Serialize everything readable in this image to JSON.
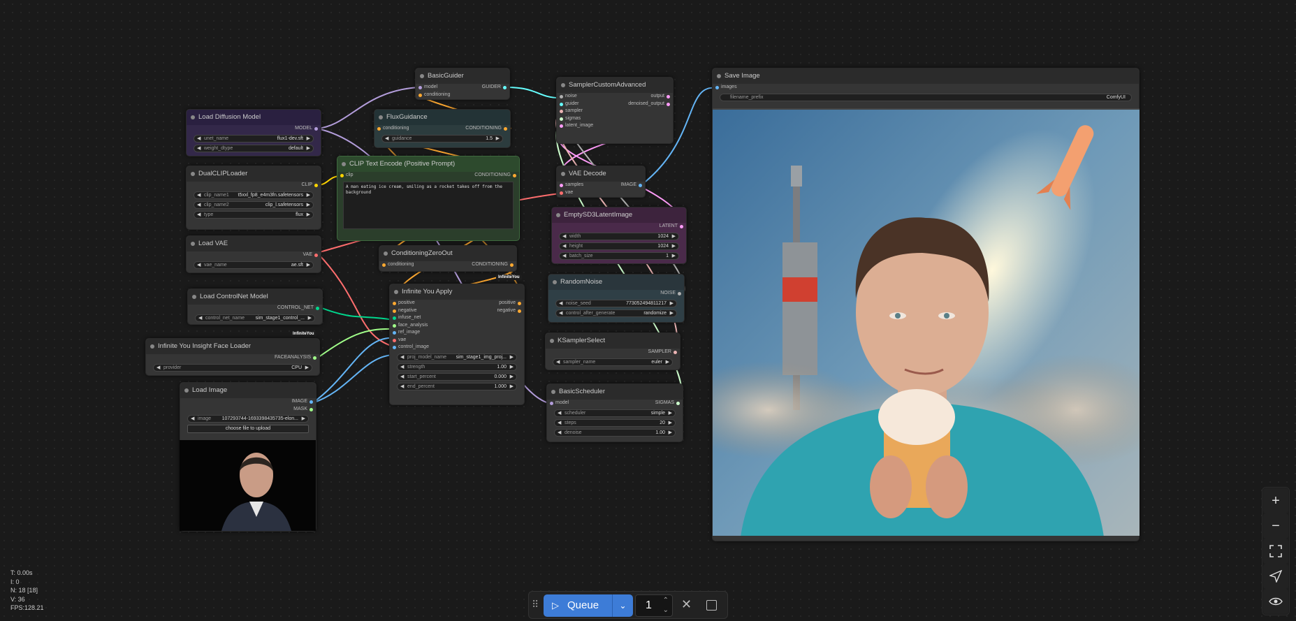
{
  "colors": {
    "model": "#b39ddb",
    "clip": "#ffd500",
    "conditioning": "#ffa931",
    "vae": "#ff6e6e",
    "latent": "#ff9cf9",
    "image": "#64b5f6",
    "noise": "#b0b0b0",
    "sampler": "#ecb4b4",
    "sigmas": "#cdffcd",
    "guider": "#66ffff",
    "control_net": "#00d78d",
    "face": "#a1ff8a",
    "accent": "#3d7cd7"
  },
  "nodes": {
    "basic_guider": {
      "title": "BasicGuider",
      "inputs": [
        "model",
        "conditioning"
      ],
      "outputs": [
        "GUIDER"
      ]
    },
    "sampler_custom_advanced": {
      "title": "SamplerCustomAdvanced",
      "inputs": [
        "noise",
        "guider",
        "sampler",
        "sigmas",
        "latent_image"
      ],
      "outputs": [
        "output",
        "denoised_output"
      ]
    },
    "save_image": {
      "title": "Save Image",
      "inputs": [
        "images"
      ],
      "widgets": [
        {
          "label": "filename_prefix",
          "value": "ComfyUI"
        }
      ]
    },
    "load_diffusion_model": {
      "title": "Load Diffusion Model",
      "outputs": [
        "MODEL"
      ],
      "widgets": [
        {
          "label": "unet_name",
          "value": "flux1-dev.sft"
        },
        {
          "label": "weight_dtype",
          "value": "default"
        }
      ]
    },
    "flux_guidance": {
      "title": "FluxGuidance",
      "inputs": [
        "conditioning"
      ],
      "outputs": [
        "CONDITIONING"
      ],
      "widgets": [
        {
          "label": "guidance",
          "value": "1.5"
        }
      ]
    },
    "dual_clip_loader": {
      "title": "DualCLIPLoader",
      "outputs": [
        "CLIP"
      ],
      "widgets": [
        {
          "label": "clip_name1",
          "value": "t5xxl_fp8_e4m3fn.safetensors"
        },
        {
          "label": "clip_name2",
          "value": "clip_l.safetensors"
        },
        {
          "label": "type",
          "value": "flux"
        }
      ]
    },
    "clip_text_encode": {
      "title": "CLIP Text Encode (Positive Prompt)",
      "inputs": [
        "clip"
      ],
      "outputs": [
        "CONDITIONING"
      ],
      "text": "A man eating ice cream, smiling as a rocket takes off from the background"
    },
    "vae_decode": {
      "title": "VAE Decode",
      "inputs": [
        "samples",
        "vae"
      ],
      "outputs": [
        "IMAGE"
      ]
    },
    "empty_latent": {
      "title": "EmptySD3LatentImage",
      "outputs": [
        "LATENT"
      ],
      "widgets": [
        {
          "label": "width",
          "value": "1024"
        },
        {
          "label": "height",
          "value": "1024"
        },
        {
          "label": "batch_size",
          "value": "1"
        }
      ]
    },
    "load_vae": {
      "title": "Load VAE",
      "outputs": [
        "VAE"
      ],
      "widgets": [
        {
          "label": "vae_name",
          "value": "ae.sft"
        }
      ]
    },
    "conditioning_zero_out": {
      "title": "ConditioningZeroOut",
      "inputs": [
        "conditioning"
      ],
      "outputs": [
        "CONDITIONING"
      ],
      "badge": "InfiniteYou"
    },
    "random_noise": {
      "title": "RandomNoise",
      "outputs": [
        "NOISE"
      ],
      "widgets": [
        {
          "label": "noise_seed",
          "value": "773052494811217"
        },
        {
          "label": "control_after_generate",
          "value": "randomize"
        }
      ]
    },
    "load_controlnet": {
      "title": "Load ControlNet Model",
      "outputs": [
        "CONTROL_NET"
      ],
      "widgets": [
        {
          "label": "control_net_name",
          "value": "sim_stage1_control_..."
        }
      ],
      "badge": "InfiniteYou"
    },
    "infinite_you_apply": {
      "title": "Infinite You Apply",
      "inputs": [
        "positive",
        "negative",
        "infuse_net",
        "face_analysis",
        "ref_image",
        "vae",
        "control_image"
      ],
      "outputs": [
        "positive",
        "negative"
      ],
      "widgets": [
        {
          "label": "proj_model_name",
          "value": "sim_stage1_img_proj..."
        },
        {
          "label": "strength",
          "value": "1.00"
        },
        {
          "label": "start_percent",
          "value": "0.000"
        },
        {
          "label": "end_percent",
          "value": "1.000"
        }
      ]
    },
    "ksampler_select": {
      "title": "KSamplerSelect",
      "outputs": [
        "SAMPLER"
      ],
      "widgets": [
        {
          "label": "sampler_name",
          "value": "euler"
        }
      ]
    },
    "face_loader": {
      "title": "Infinite You Insight Face Loader",
      "outputs": [
        "FACEANALYSIS"
      ],
      "widgets": [
        {
          "label": "provider",
          "value": "CPU"
        }
      ]
    },
    "basic_scheduler": {
      "title": "BasicScheduler",
      "inputs": [
        "model"
      ],
      "outputs": [
        "SIGMAS"
      ],
      "widgets": [
        {
          "label": "scheduler",
          "value": "simple"
        },
        {
          "label": "steps",
          "value": "20"
        },
        {
          "label": "denoise",
          "value": "1.00"
        }
      ]
    },
    "load_image": {
      "title": "Load Image",
      "outputs": [
        "IMAGE",
        "MASK"
      ],
      "widgets": [
        {
          "label": "image",
          "value": "107293744-1693398435735-elon..."
        }
      ],
      "upload_label": "choose file to upload"
    }
  },
  "stats": {
    "t": "T: 0.00s",
    "i": "I: 0",
    "n": "N: 18 [18]",
    "v": "V: 36",
    "fps": "FPS:128.21"
  },
  "queue": {
    "label": "Queue",
    "count": "1"
  },
  "side_controls": [
    "zoom-in-icon",
    "zoom-out-icon",
    "fit-view-icon",
    "pointer-icon",
    "eye-icon"
  ]
}
